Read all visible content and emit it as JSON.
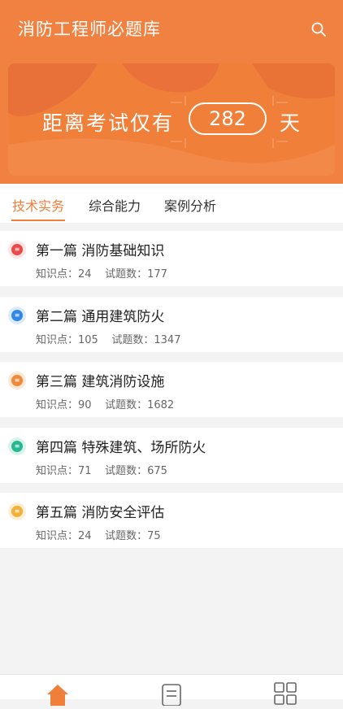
{
  "header": {
    "title": "消防工程师必题库",
    "search_icon": "search-icon"
  },
  "banner": {
    "prefix": "距离考试仅有",
    "days": "282",
    "suffix": "天"
  },
  "tabs": [
    {
      "label": "技术实务",
      "active": true
    },
    {
      "label": "综合能力",
      "active": false
    },
    {
      "label": "案例分析",
      "active": false
    }
  ],
  "chapters": [
    {
      "title": "第一篇 消防基础知识",
      "kp_label": "知识点：",
      "kp": "24",
      "q_label": "试题数：",
      "q": "177",
      "color": "#e94a4a",
      "ring": "#fde3e3"
    },
    {
      "title": "第二篇 通用建筑防火",
      "kp_label": "知识点：",
      "kp": "105",
      "q_label": "试题数：",
      "q": "1347",
      "color": "#2f86e6",
      "ring": "#dbeafd"
    },
    {
      "title": "第三篇 建筑消防设施",
      "kp_label": "知识点：",
      "kp": "90",
      "q_label": "试题数：",
      "q": "1682",
      "color": "#f08a3a",
      "ring": "#fde8d6"
    },
    {
      "title": "第四篇 特殊建筑、场所防火",
      "kp_label": "知识点：",
      "kp": "71",
      "q_label": "试题数：",
      "q": "675",
      "color": "#27b893",
      "ring": "#d8f3ea"
    },
    {
      "title": "第五篇 消防安全评估",
      "kp_label": "知识点：",
      "kp": "24",
      "q_label": "试题数：",
      "q": "75",
      "color": "#f2b03a",
      "ring": "#fcefd4"
    }
  ],
  "nav": [
    {
      "icon": "home-icon",
      "active": true
    },
    {
      "icon": "list-icon",
      "active": false
    },
    {
      "icon": "grid-icon",
      "active": false
    }
  ],
  "colors": {
    "accent": "#f07f3a"
  }
}
